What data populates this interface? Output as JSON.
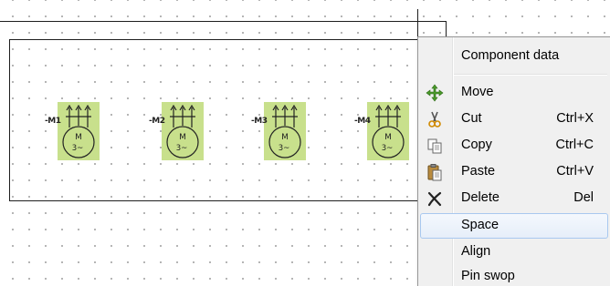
{
  "diagram": {
    "motors": [
      {
        "tag": "-M1",
        "symbol": "M",
        "phase": "3~"
      },
      {
        "tag": "-M2",
        "symbol": "M",
        "phase": "3~"
      },
      {
        "tag": "-M3",
        "symbol": "M",
        "phase": "3~"
      },
      {
        "tag": "-M4",
        "symbol": "M",
        "phase": "3~"
      }
    ],
    "highlight_color": "#c8e08c"
  },
  "context_menu": {
    "items": [
      {
        "label": "Component data",
        "shortcut": "",
        "icon": ""
      },
      {
        "label": "Move",
        "shortcut": "",
        "icon": "move-icon"
      },
      {
        "label": "Cut",
        "shortcut": "Ctrl+X",
        "icon": "cut-icon"
      },
      {
        "label": "Copy",
        "shortcut": "Ctrl+C",
        "icon": "copy-icon"
      },
      {
        "label": "Paste",
        "shortcut": "Ctrl+V",
        "icon": "paste-icon"
      },
      {
        "label": "Delete",
        "shortcut": "Del",
        "icon": "delete-icon"
      },
      {
        "label": "Space",
        "shortcut": "",
        "icon": "",
        "state": "hovered"
      },
      {
        "label": "Align",
        "shortcut": "",
        "icon": ""
      },
      {
        "label": "Pin swop",
        "shortcut": "",
        "icon": ""
      }
    ]
  }
}
